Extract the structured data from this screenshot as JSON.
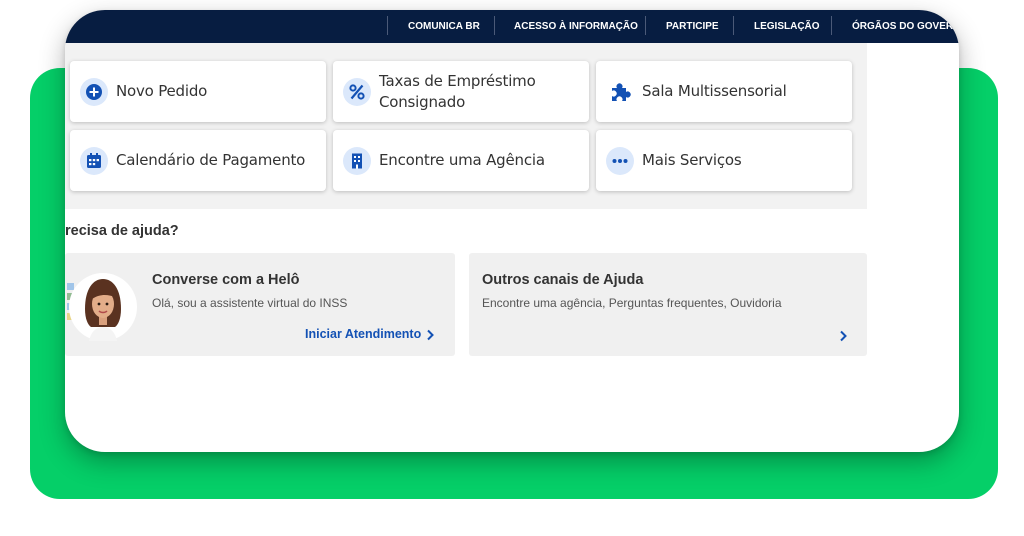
{
  "topbar": {
    "items": [
      "COMUNICA BR",
      "ACESSO À INFORMAÇÃO",
      "PARTICIPE",
      "LEGISLAÇÃO",
      "ÓRGÃOS DO GOVERNO"
    ]
  },
  "services": [
    {
      "label": "Novo Pedido",
      "icon": "plus-circle-icon"
    },
    {
      "label": "Taxas de Empréstimo Consignado",
      "icon": "percent-icon"
    },
    {
      "label": "Sala Multissensorial",
      "icon": "puzzle-icon"
    },
    {
      "label": "Calendário de Pagamento",
      "icon": "calendar-icon"
    },
    {
      "label": "Encontre uma Agência",
      "icon": "building-icon"
    },
    {
      "label": "Mais Serviços",
      "icon": "more-dots-icon"
    }
  ],
  "help": {
    "title": "recisa de ajuda?",
    "assistant": {
      "heading": "Converse com a Helô",
      "subtitle": "Olá, sou a assistente virtual do INSS",
      "link": "Iniciar Atendimento"
    },
    "channels": {
      "heading": "Outros canais de Ajuda",
      "subtitle": "Encontre uma agência, Perguntas frequentes, Ouvidoria"
    }
  },
  "colors": {
    "background_accent": "#05cf68",
    "topbar": "#071d41",
    "link": "#1351b4",
    "icon": "#1351b4",
    "icon_bg": "#dbe8fb"
  }
}
